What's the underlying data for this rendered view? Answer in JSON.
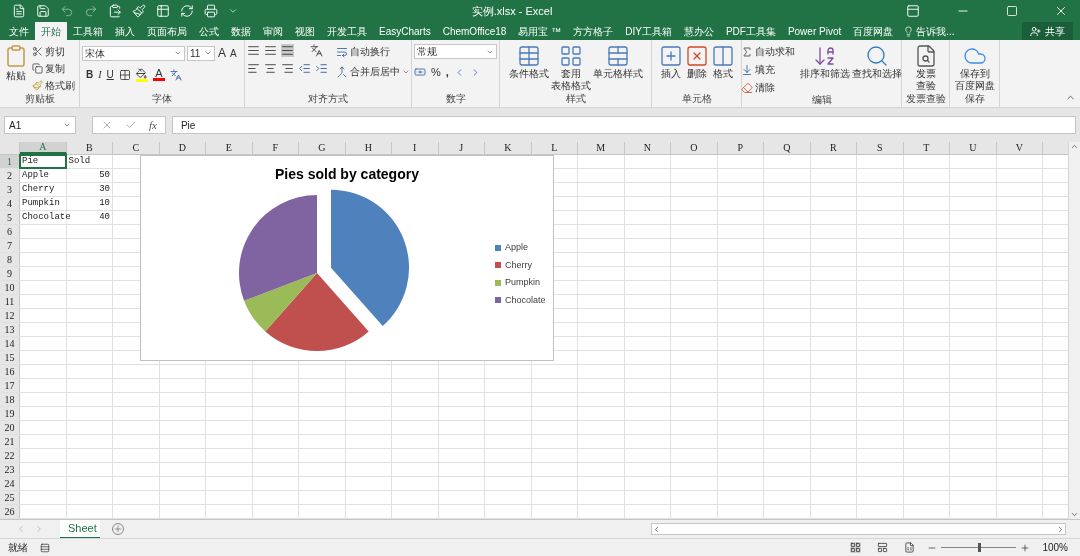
{
  "title_bar": {
    "title": "实例.xlsx - Excel"
  },
  "menu_tabs": [
    {
      "label": "文件",
      "selected": false
    },
    {
      "label": "开始",
      "selected": true
    },
    {
      "label": "工具箱",
      "selected": false
    },
    {
      "label": "插入",
      "selected": false
    },
    {
      "label": "页面布局",
      "selected": false
    },
    {
      "label": "公式",
      "selected": false
    },
    {
      "label": "数据",
      "selected": false
    },
    {
      "label": "审阅",
      "selected": false
    },
    {
      "label": "视图",
      "selected": false
    },
    {
      "label": "开发工具",
      "selected": false
    },
    {
      "label": "EasyCharts",
      "selected": false
    },
    {
      "label": "ChemOffice18",
      "selected": false
    },
    {
      "label": "易用宝 ™",
      "selected": false
    },
    {
      "label": "方方格子",
      "selected": false
    },
    {
      "label": "DIY工具箱",
      "selected": false
    },
    {
      "label": "慧办公",
      "selected": false
    },
    {
      "label": "PDF工具集",
      "selected": false
    },
    {
      "label": "Power Pivot",
      "selected": false
    },
    {
      "label": "百度网盘",
      "selected": false
    }
  ],
  "tell_me": "告诉我...",
  "share": "共享",
  "ribbon": {
    "clipboard": {
      "label": "剪贴板",
      "paste": "粘贴",
      "cut": "剪切",
      "copy": "复制",
      "format_painter": "格式刷"
    },
    "font": {
      "label": "字体",
      "font_name": "宋体",
      "font_size": "11",
      "grow": "A",
      "shrink": "A",
      "bold": "B",
      "italic": "I",
      "underline": "U",
      "font_color": "A"
    },
    "alignment": {
      "label": "对齐方式",
      "wrap_text": "自动换行",
      "merge_center": "合并后居中"
    },
    "number": {
      "label": "数字",
      "format": "常规",
      "percent": "%",
      "comma": ","
    },
    "styles": {
      "label": "样式",
      "buttons": [
        [
          "条件格式"
        ],
        [
          "套用",
          "表格格式"
        ],
        [
          "单元格样式"
        ]
      ]
    },
    "cells": {
      "label": "单元格",
      "buttons": [
        [
          "插入"
        ],
        [
          "删除"
        ],
        [
          "格式"
        ]
      ]
    },
    "editing": {
      "label": "编辑",
      "autosum": "自动求和",
      "fill": "填充",
      "clear": "清除",
      "sort_filter": "排序和筛选",
      "find_select": "查找和选择"
    },
    "invoice": {
      "label": "发票查验",
      "button": [
        "发票",
        "查验"
      ]
    },
    "save": {
      "label": "保存",
      "button": [
        "保存到",
        "百度网盘"
      ]
    }
  },
  "formula_bar": {
    "name_box": "A1",
    "insert_function": "fx",
    "formula": "Pie"
  },
  "sheet": {
    "columns": [
      {
        "label": "A",
        "selected": true
      },
      {
        "label": "B",
        "selected": false
      },
      {
        "label": "C",
        "selected": false
      },
      {
        "label": "D",
        "selected": false
      },
      {
        "label": "E",
        "selected": false
      },
      {
        "label": "F",
        "selected": false
      },
      {
        "label": "G",
        "selected": false
      },
      {
        "label": "H",
        "selected": false
      },
      {
        "label": "I",
        "selected": false
      },
      {
        "label": "J",
        "selected": false
      },
      {
        "label": "K",
        "selected": false
      },
      {
        "label": "L",
        "selected": false
      },
      {
        "label": "M",
        "selected": false
      },
      {
        "label": "N",
        "selected": false
      },
      {
        "label": "O",
        "selected": false
      },
      {
        "label": "P",
        "selected": false
      },
      {
        "label": "Q",
        "selected": false
      },
      {
        "label": "R",
        "selected": false
      },
      {
        "label": "S",
        "selected": false
      },
      {
        "label": "T",
        "selected": false
      },
      {
        "label": "U",
        "selected": false
      },
      {
        "label": "V",
        "selected": false
      }
    ],
    "rows": [
      {
        "label": "1",
        "selected": true,
        "cells": [
          {
            "text": "Pie",
            "kind": "text",
            "selected": true
          },
          {
            "text": "Sold",
            "kind": "text",
            "selected": false
          }
        ]
      },
      {
        "label": "2",
        "selected": false,
        "cells": [
          {
            "text": "Apple",
            "kind": "text",
            "selected": false
          },
          {
            "text": "50",
            "kind": "number",
            "selected": false
          }
        ]
      },
      {
        "label": "3",
        "selected": false,
        "cells": [
          {
            "text": "Cherry",
            "kind": "text",
            "selected": false
          },
          {
            "text": "30",
            "kind": "number",
            "selected": false
          }
        ]
      },
      {
        "label": "4",
        "selected": false,
        "cells": [
          {
            "text": "Pumpkin",
            "kind": "text",
            "selected": false
          },
          {
            "text": "10",
            "kind": "number",
            "selected": false
          }
        ]
      },
      {
        "label": "5",
        "selected": false,
        "cells": [
          {
            "text": "Chocolate",
            "kind": "text",
            "selected": false
          },
          {
            "text": "40",
            "kind": "number",
            "selected": false
          }
        ]
      },
      {
        "label": "6",
        "selected": false
      },
      {
        "label": "7",
        "selected": false
      },
      {
        "label": "8",
        "selected": false
      },
      {
        "label": "9",
        "selected": false
      },
      {
        "label": "10",
        "selected": false
      },
      {
        "label": "11",
        "selected": false
      },
      {
        "label": "12",
        "selected": false
      },
      {
        "label": "13",
        "selected": false
      },
      {
        "label": "14",
        "selected": false
      },
      {
        "label": "15",
        "selected": false
      },
      {
        "label": "16",
        "selected": false
      },
      {
        "label": "17",
        "selected": false
      },
      {
        "label": "18",
        "selected": false
      },
      {
        "label": "19",
        "selected": false
      },
      {
        "label": "20",
        "selected": false
      },
      {
        "label": "21",
        "selected": false
      },
      {
        "label": "22",
        "selected": false
      },
      {
        "label": "23",
        "selected": false
      },
      {
        "label": "24",
        "selected": false
      },
      {
        "label": "25",
        "selected": false
      },
      {
        "label": "26",
        "selected": false
      }
    ]
  },
  "chart": {
    "chart_data": {
      "type": "pie",
      "title": "Pies sold by category",
      "categories": [
        "Apple",
        "Cherry",
        "Pumpkin",
        "Chocolate"
      ],
      "legend": "right",
      "series": [
        {
          "colors": [
            "#4f81bd",
            "#c0504d",
            "#9bbb59",
            "#8064a2"
          ],
          "values": [
            38.46,
            23.08,
            7.69,
            30.77
          ]
        }
      ]
    }
  },
  "sheet_tabs": [
    {
      "label": "Sheet",
      "selected": true
    }
  ],
  "status_bar": {
    "status": "就绪",
    "zoom": "100%",
    "zoom_slider": {
      "level": 0.5
    }
  }
}
